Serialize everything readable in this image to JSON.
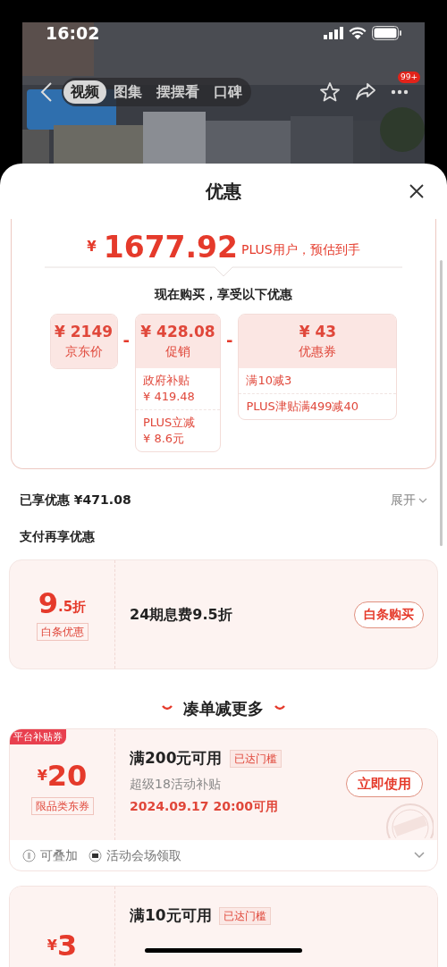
{
  "status_bar": {
    "time": "16:02"
  },
  "nav": {
    "tabs": [
      {
        "label": "视频",
        "selected": true
      },
      {
        "label": "图集",
        "selected": false
      },
      {
        "label": "摆摆看",
        "selected": false
      },
      {
        "label": "口碑",
        "selected": false
      }
    ],
    "badge": "99+"
  },
  "sheet": {
    "title": "优惠"
  },
  "price": {
    "currency": "¥",
    "amount": "1677.92",
    "note": "PLUS用户，预估到手",
    "subtitle": "现在购买，享受以下优惠",
    "boxes": [
      {
        "value": "¥ 2149",
        "label": "京东价"
      },
      {
        "operator": "-",
        "value": "¥ 428.08",
        "label": "促销",
        "items": [
          {
            "name": "政府补贴",
            "amount": "¥ 419.48"
          },
          {
            "name": "PLUS立减",
            "amount": "¥ 8.6元"
          }
        ]
      },
      {
        "operator": "-",
        "value": "¥ 43",
        "label": "优惠券",
        "items": [
          {
            "name": "满10减3"
          },
          {
            "name": "PLUS津贴满499减40"
          }
        ]
      }
    ]
  },
  "summary": {
    "text": "已享优惠 ¥471.08",
    "toggle": "展开"
  },
  "pay_section": {
    "title": "支付再享优惠",
    "big": "9",
    "small": ".5折",
    "tag": "白条优惠",
    "description": "24期息费9.5折",
    "button": "白条购买"
  },
  "more": {
    "title": "凑单减更多",
    "coupons": [
      {
        "badge": "平台补贴券",
        "currency": "¥",
        "amount": "20",
        "tag": "限品类东券",
        "condition": "满200元可用",
        "status": "已达门槛",
        "subtitle": "超级18活动补贴",
        "date": "2024.09.17 20:00可用",
        "button": "立即使用",
        "claimed": true,
        "footer": [
          "可叠加",
          "活动会场领取"
        ]
      },
      {
        "currency": "¥",
        "amount": "3",
        "condition": "满10元可用",
        "status": "已达门槛"
      }
    ]
  }
}
